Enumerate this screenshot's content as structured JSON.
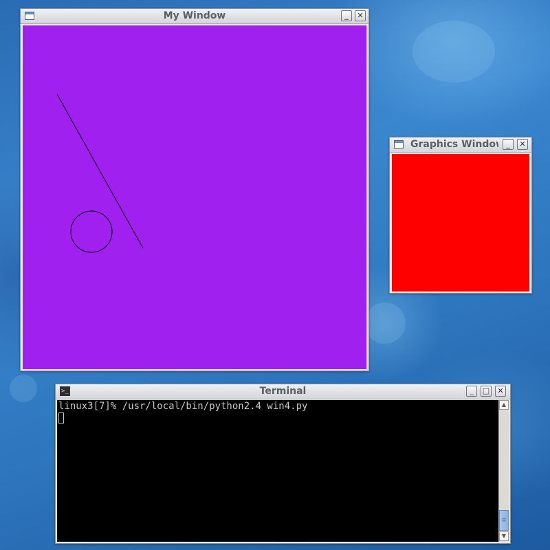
{
  "desktop": {
    "background_color": "#2f78c0"
  },
  "my_window": {
    "title": "My Window",
    "canvas_color": "#a020f0",
    "shape_stroke": "#000000",
    "buttons": {
      "minimize": "_",
      "close": "✕"
    }
  },
  "graphics_window": {
    "title": "Graphics Window",
    "canvas_color": "#ff0000",
    "buttons": {
      "minimize": "_",
      "close": "✕"
    }
  },
  "terminal": {
    "title": "Terminal",
    "prompt_line": "linux3[7]% /usr/local/bin/python2.4 win4.py",
    "background_color": "#000000",
    "text_color": "#c8c8c8",
    "buttons": {
      "minimize": "_",
      "maximize": "□",
      "close": "✕"
    },
    "scrollbar": {
      "up": "▲",
      "down": "▼",
      "grip": "≡"
    }
  }
}
